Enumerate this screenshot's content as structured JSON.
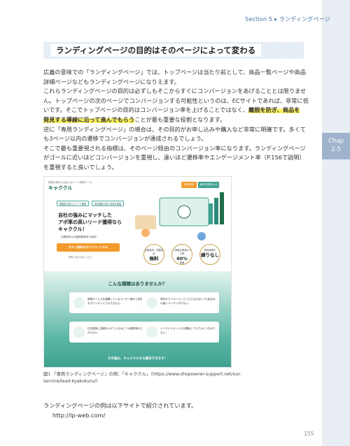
{
  "header": {
    "section": "Section 5 ▸ ランディングページ"
  },
  "side_tab": {
    "line1": "Chap",
    "line2": "2-5"
  },
  "heading": "ランディングページの目的はそのページによって変わる",
  "body": {
    "p1": "広義の意味での「ランディングページ」では、トップページは当たり前として、商品一覧ページや商品詳細ページなどもランディングページになりえます。",
    "p2_a": "これらランディングページの目的は必ずしもそこからすぐにコンバージョンをあげることとは限りません。トップページの次のページでコンバージョンする可能性というのは、ECサイトであれば、非常に低いです。そこでトップページの目的はコンバージョン率を上げることではなく、",
    "p2_hl1": "離脱を防ぎ、商品を",
    "p2_hl2": "発見する導線に沿って進んでもらう",
    "p2_b": "ことが最も重要な役割となります。",
    "p3": "逆に「専用ランディングページ」の場合は、その目的がお申し込みや購入など非常に明確です。多くても3ページ以内の遷移でコンバージョンが達成されるでしょう。",
    "p4": "そこで最も重要視される指標は、そのページ経由のコンバージョン率になります。ランディングページがゴールに近いほどコンバージョンを重視し、遠いほど遷移率やエンゲージメント率（P.156で説明）を重視すると良いでしょう。"
  },
  "figure": {
    "logo_small": "理想の案件に出会えるリード獲得ツール",
    "logo": "キャククル",
    "btn_doc": "資料請求",
    "btn_contact": "無料お問合わせ",
    "tag1": "掲載型の新しいリード獲得",
    "tag2": "成功確度の高い商談を実現",
    "headline1": "自社の強みにマッチした",
    "headline2": "アポ率の高いリード獲得なら",
    "headline3": "キャククル！",
    "sub": "初期費用＆月額掲載費用も無料！",
    "cta": "今すぐ資料をダウンロードする",
    "note": "お問い合わせはこちら",
    "badge1_top": "初期費用・掲載費用",
    "badge1_main": "無料",
    "badge2_top": "ご掲載企業様のアポ率",
    "badge2_main": "60%",
    "badge2_bottom": "実績",
    "badge3_top": "契約期間の",
    "badge3_main": "縛りなし",
    "issues_title": "こんな課題はありませんか？",
    "issue1": "新規サービスを展開しているユーザー様から資料をダウンロードされたません。",
    "issue2": "資料ダウンロードしてくださる方はいても見込みの高いユーザーが少ない。",
    "issue3": "広告費用に多額をかけているのにアポ獲得率が上がらない。",
    "issue4": "インサイドセールスを開始してもアポにつながらない。",
    "solve": "その悩み、キャククルなら解決できます！"
  },
  "caption": "図1 「専用ランディングページ」の例：「キャククル」（https://www.shopowner-support.net/our-service/lead-kyakukuru/）",
  "after_text": "ランディングページの例は以下サイトで紹介されています。",
  "url": "http://lp-web.com/",
  "page_number": "155",
  "colors": {
    "accent": "#3d6fa3",
    "tab": "#9fb3cc",
    "highlight": "#fff35a",
    "lp_green": "#3fa290",
    "lp_orange": "#f39a2c"
  }
}
